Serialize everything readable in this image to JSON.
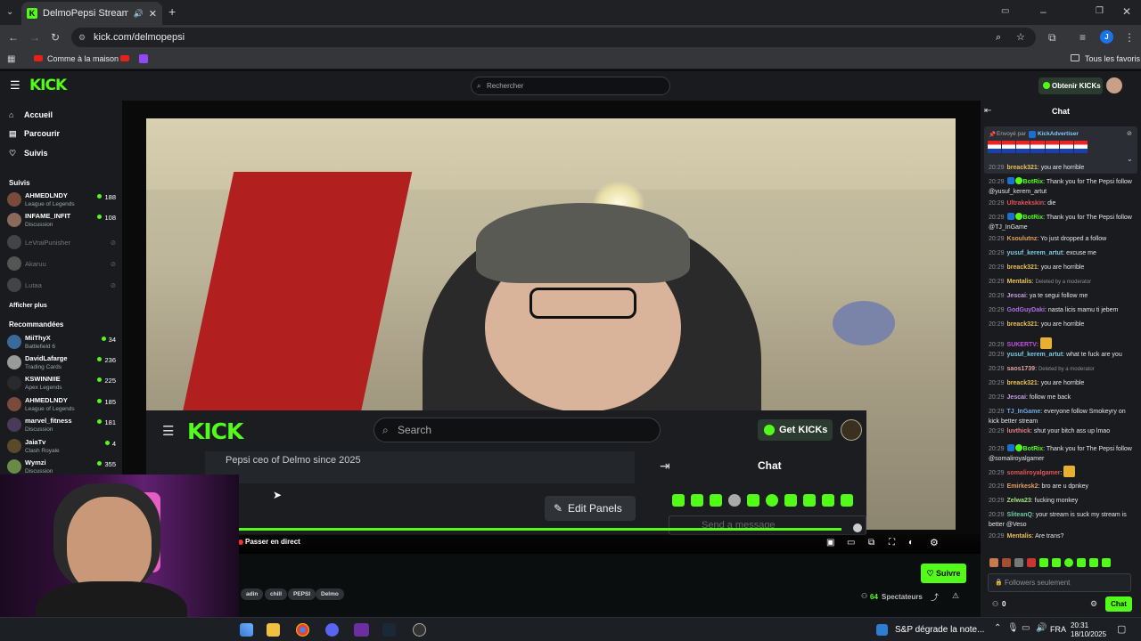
{
  "browser": {
    "tab_title": "DelmoPepsi Stream - Watc",
    "url": "kick.com/delmopepsi",
    "bookmarks": [
      "Comme à la maison"
    ],
    "bookmarks_right": "Tous les favoris",
    "profile_initial": "J"
  },
  "kick": {
    "logo": "KICK",
    "search_placeholder": "Rechercher",
    "get_kicks": "Obtenir KICKs"
  },
  "sidebar": {
    "nav": [
      {
        "label": "Accueil",
        "icon": "home-icon"
      },
      {
        "label": "Parcourir",
        "icon": "browse-icon"
      },
      {
        "label": "Suivis",
        "icon": "heart-icon"
      }
    ],
    "following_title": "Suivis",
    "following": [
      {
        "name": "AHMEDLNDY",
        "game": "League of Legends",
        "viewers": "188",
        "color": "#7a4a3a"
      },
      {
        "name": "INFAME_INFIT",
        "game": "Discussion",
        "viewers": "108",
        "color": "#8a6a5a"
      },
      {
        "name": "LeVraiPunisher",
        "game": "",
        "viewers": "",
        "color": "#444"
      },
      {
        "name": "Akaruu",
        "game": "",
        "viewers": "",
        "color": "#555"
      },
      {
        "name": "Lutaa",
        "game": "",
        "viewers": "",
        "color": "#444"
      }
    ],
    "show_more": "Afficher plus",
    "recommended_title": "Recommandées",
    "recommended": [
      {
        "name": "MiiThyX",
        "game": "Battlefield 6",
        "viewers": "34",
        "color": "#3a6a9a"
      },
      {
        "name": "DavidLafarge",
        "game": "Trading Cards",
        "viewers": "236",
        "color": "#9a9a9a"
      },
      {
        "name": "KSWINNIIE",
        "game": "Apex Legends",
        "viewers": "225",
        "color": "#2a2a2a"
      },
      {
        "name": "AHMEDLNDY",
        "game": "League of Legends",
        "viewers": "185",
        "color": "#7a4a3a"
      },
      {
        "name": "marvel_fitness",
        "game": "Discussion",
        "viewers": "181",
        "color": "#4a3a5a"
      },
      {
        "name": "JaiaTv",
        "game": "Clash Royale",
        "viewers": "4",
        "color": "#5a4a2a"
      },
      {
        "name": "Wymzi",
        "game": "Discussion",
        "viewers": "355",
        "color": "#6a8a4a"
      }
    ]
  },
  "overlay": {
    "logo": "KICK",
    "search": "Search",
    "get_kicks": "Get KICKs",
    "panel_text": "Pepsi ceo of Delmo since 2025",
    "edit_panels": "Edit Panels",
    "chat": "Chat",
    "send_placeholder": "Send a message"
  },
  "player": {
    "live_label": "Passer en direct"
  },
  "stream": {
    "tags": [
      "adin",
      "chill",
      "PEPSI",
      "Delmo"
    ],
    "follow": "Suivre",
    "viewers": "64",
    "viewers_label": "Spectateurs"
  },
  "chat": {
    "title": "Chat",
    "pinned_prefix": "Envoyé par",
    "pinned_user": "KickAdvertiser",
    "messages": [
      {
        "time": "20:29",
        "user": "breack321",
        "color": "#e8c15a",
        "text": "you are horrible"
      },
      {
        "time": "20:29",
        "user": "BotRix",
        "color": "#53fc18",
        "bot": true,
        "text": "Thank you for The Pepsi follow @yusuf_kerem_artut"
      },
      {
        "time": "20:29",
        "user": "Ultrakekskin",
        "color": "#e05555",
        "text": "die"
      },
      {
        "time": "20:29",
        "user": "BotRix",
        "color": "#53fc18",
        "bot": true,
        "text": "Thank you for The Pepsi follow @TJ_InGame"
      },
      {
        "time": "20:29",
        "user": "Ksoulutnz",
        "color": "#e0a060",
        "text": "Yo just dropped a follow"
      },
      {
        "time": "20:29",
        "user": "yusuf_kerem_artut",
        "color": "#7ec8e3",
        "text": "excuse me"
      },
      {
        "time": "20:29",
        "user": "breack321",
        "color": "#e8c15a",
        "text": "you are horrible"
      },
      {
        "time": "20:29",
        "user": "Mentalis",
        "color": "#e8c15a",
        "deleted": true,
        "text": "Deleted by a moderator"
      },
      {
        "time": "20:29",
        "user": "Jescai",
        "color": "#c0a0e0",
        "text": "ya te segui follow me"
      },
      {
        "time": "20:29",
        "user": "GodGuyDaki",
        "color": "#b070e0",
        "text": "nasta licis mamu ti jebem"
      },
      {
        "time": "20:29",
        "user": "breack321",
        "color": "#e8c15a",
        "text": "you are horrible"
      },
      {
        "time": "20:29",
        "user": "SUKERTV",
        "color": "#c050e0",
        "emote": true,
        "text": ""
      },
      {
        "time": "20:29",
        "user": "yusuf_kerem_artut",
        "color": "#7ec8e3",
        "text": "what te fuck are you"
      },
      {
        "time": "20:29",
        "user": "saos1739",
        "color": "#e0a0a0",
        "deleted": true,
        "text": "Deleted by a moderator"
      },
      {
        "time": "20:29",
        "user": "breack321",
        "color": "#e8c15a",
        "text": "you are horrible"
      },
      {
        "time": "20:29",
        "user": "Jescai",
        "color": "#c0a0e0",
        "text": "follow me back"
      },
      {
        "time": "20:29",
        "user": "TJ_InGame",
        "color": "#70a8e0",
        "text": "everyone follow Smokeyry on kick better stream"
      },
      {
        "time": "20:29",
        "user": "luvthick",
        "color": "#e08080",
        "text": "shut your bitch ass up lmao"
      },
      {
        "time": "20:29",
        "user": "BotRix",
        "color": "#53fc18",
        "bot": true,
        "text": "Thank you for The Pepsi follow @somaliroyalgamer"
      },
      {
        "time": "20:29",
        "user": "somaliroyalgamer",
        "color": "#e05555",
        "emote": true,
        "text": ""
      },
      {
        "time": "20:29",
        "user": "Emirkesk2",
        "color": "#e0a060",
        "text": "bro are u dpnkey"
      },
      {
        "time": "20:29",
        "user": "Zelwa23",
        "color": "#a0e080",
        "text": "fucking monkey"
      },
      {
        "time": "20:29",
        "user": "SliteanQ",
        "color": "#70c8a0",
        "text": "your stream is suck my stream is better @Veso"
      },
      {
        "time": "20:29",
        "user": "Mentalis",
        "color": "#e8c15a",
        "text": "Are trans?"
      }
    ],
    "input_placeholder": "Followers seulement",
    "points": "0",
    "send_button": "Chat"
  },
  "taskbar": {
    "news": "S&P dégrade la note...",
    "lang": "FRA",
    "time": "20:31",
    "date": "18/10/2025"
  }
}
